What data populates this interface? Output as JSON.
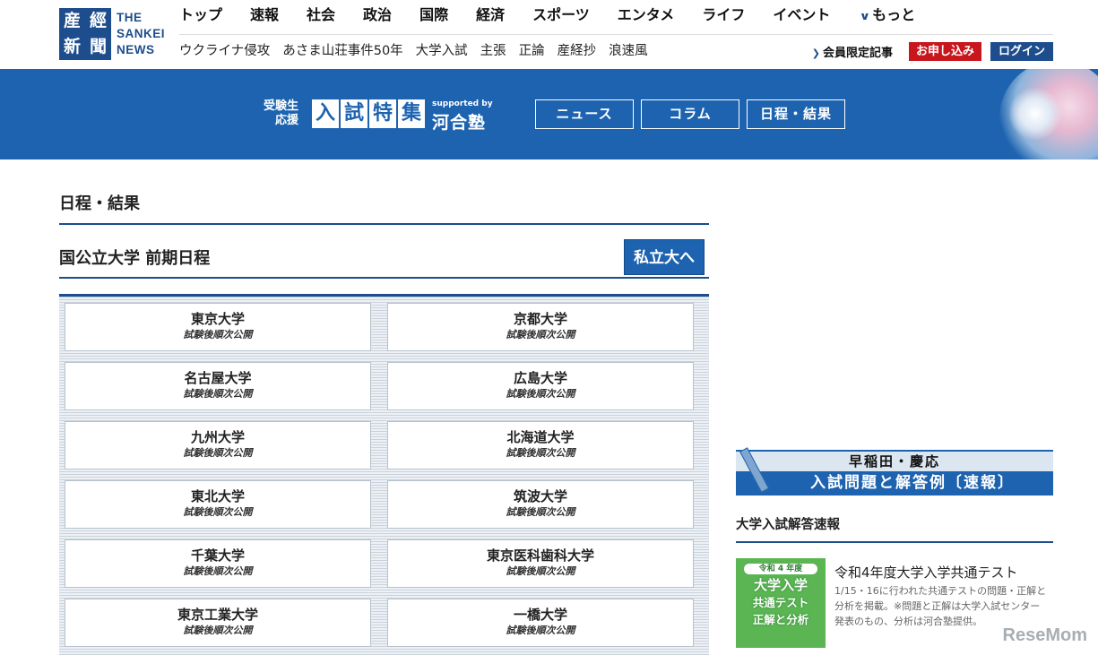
{
  "header": {
    "logo_chars": [
      "産",
      "經",
      "新",
      "聞"
    ],
    "logo_text": [
      "THE",
      "SANKEI",
      "NEWS"
    ],
    "nav_primary": [
      "トップ",
      "速報",
      "社会",
      "政治",
      "国際",
      "経済",
      "スポーツ",
      "エンタメ",
      "ライフ",
      "イベント"
    ],
    "nav_more": "もっと",
    "nav_secondary": [
      "ウクライナ侵攻",
      "あさま山荘事件50年",
      "大学入試",
      "主張",
      "正論",
      "産経抄",
      "浪速風"
    ],
    "member_link": "会員限定記事",
    "apply_button": "お申し込み",
    "login_button": "ログイン"
  },
  "banner": {
    "small_line1": "受験生",
    "small_line2": "応援",
    "title_chars": [
      "入",
      "試",
      "特",
      "集"
    ],
    "supported_by": "supported by",
    "sponsor": "河合塾",
    "tabs": [
      "ニュース",
      "コラム",
      "日程・結果"
    ]
  },
  "main": {
    "page_title": "日程・結果",
    "section_title": "国公立大学 前期日程",
    "private_button": "私立大へ",
    "universities": [
      {
        "name": "東京大学",
        "status": "試験後順次公開"
      },
      {
        "name": "京都大学",
        "status": "試験後順次公開"
      },
      {
        "name": "名古屋大学",
        "status": "試験後順次公開"
      },
      {
        "name": "広島大学",
        "status": "試験後順次公開"
      },
      {
        "name": "九州大学",
        "status": "試験後順次公開"
      },
      {
        "name": "北海道大学",
        "status": "試験後順次公開"
      },
      {
        "name": "東北大学",
        "status": "試験後順次公開"
      },
      {
        "name": "筑波大学",
        "status": "試験後順次公開"
      },
      {
        "name": "千葉大学",
        "status": "試験後順次公開"
      },
      {
        "name": "東京医科歯科大学",
        "status": "試験後順次公開"
      },
      {
        "name": "東京工業大学",
        "status": "試験後順次公開"
      },
      {
        "name": "一橋大学",
        "status": "試験後順次公開"
      }
    ]
  },
  "sidebar": {
    "ad_top": "早稲田・慶応",
    "ad_bottom": "入試問題と解答例〔速報〕",
    "section_title": "大学入試解答速報",
    "thumb_head": "令和 4 年度",
    "thumb_line1": "大学入学",
    "thumb_line2": "共通テスト",
    "thumb_line3": "正解と分析",
    "article_title": "令和4年度大学入学共通テスト",
    "article_desc": "1/15・16に行われた共通テストの問題・正解と分析を掲載。※問題と正解は大学入試センター発表のもの、分析は河合塾提供。"
  },
  "watermark": "ReseMom",
  "colors": {
    "brand_blue": "#1d4d8c",
    "banner_blue": "#1d63b0",
    "apply_red": "#c8161d",
    "thumb_green": "#5ab552"
  }
}
